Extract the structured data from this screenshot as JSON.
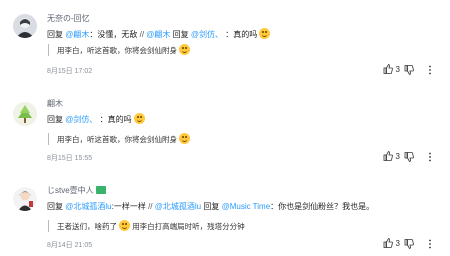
{
  "comments": [
    {
      "author": "无奈の-回忆",
      "reply_prefix": "回复",
      "mention1": "@翩木",
      "text1": "没懂，无敌",
      "sep": "//",
      "mention2": "@翩木",
      "reply_prefix2": "回复",
      "mention3": "@剑仿、",
      "text2": "：真的吗",
      "quote": "用李白，听这首歌，你将会剑仙附身",
      "date": "8月15日 17:02",
      "likes": "3"
    },
    {
      "author": "翩木",
      "reply_prefix": "回复",
      "mention1": "@剑仿、",
      "text1": "：真的吗",
      "quote": "用李白，听这首歌，你将会剑仙附身",
      "date": "8月15日 15:55",
      "likes": "3"
    },
    {
      "author": "じstve壹中人",
      "reply_prefix": "回复",
      "mention1": "@北城孤酒lu",
      "text1": ":一样一样",
      "sep": "//",
      "mention2": "@北城孤酒lu",
      "reply_prefix2": "回复",
      "mention3": "@Music Time",
      "text2": "：你也是剑仙粉丝？我也是。",
      "quote1": "王者送们，啥药了",
      "quote2": "用李白打高端局时听，残塔分分钟",
      "date": "8月14日 21:05",
      "likes": "3"
    }
  ]
}
